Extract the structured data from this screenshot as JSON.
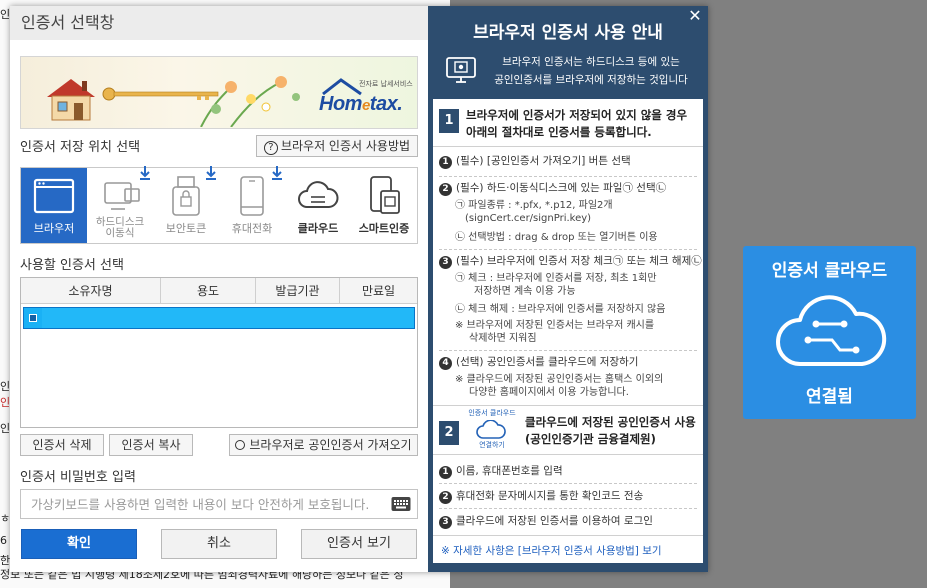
{
  "background": {
    "fragments": [
      "인증",
      "인",
      "인",
      "인",
      "ㅎ",
      "6",
      "한",
      "차",
      "정보 또는 같은 법 시행령 제18조제2호에 따른 범죄경력자료에 해당하는 정보나 같은 정"
    ]
  },
  "dialog": {
    "title": "인증서 선택창",
    "banner": {
      "brand_small": "전자료 납세서비스",
      "brand_home": "Hom",
      "brand_e": "e",
      "brand_tax": "tax."
    },
    "storage_label": "인증서 저장 위치 선택",
    "browser_cert_howto_button": "브라우저 인증서 사용방법",
    "storage_options": [
      {
        "label": "브라우저",
        "icon": "browser-icon"
      },
      {
        "label": "하드디스크\n이동식",
        "icon": "usb-drive-icon"
      },
      {
        "label": "보안토큰",
        "icon": "security-token-icon"
      },
      {
        "label": "휴대전화",
        "icon": "mobile-phone-icon"
      },
      {
        "label": "클라우드",
        "icon": "cloud-icon"
      },
      {
        "label": "스마트인증",
        "icon": "smart-auth-icon"
      }
    ],
    "cert_select_label": "사용할 인증서 선택",
    "table_headers": [
      "소유자명",
      "용도",
      "발급기관",
      "만료일"
    ],
    "delete_cert_button": "인증서 삭제",
    "copy_cert_button": "인증서 복사",
    "import_cert_button": "브라우저로 공인인증서 가져오기",
    "password_label": "인증서 비밀번호 입력",
    "password_placeholder": "가상키보드를 사용하면 입력한 내용이 보다 안전하게 보호됩니다.",
    "confirm_button": "확인",
    "cancel_button": "취소",
    "view_cert_button": "인증서 보기"
  },
  "guide": {
    "title": "브라우저 인증서 사용 안내",
    "subtitle_line1": "브라우저 인증서는 하드디스크 등에 있는",
    "subtitle_line2": "공인인증서를 브라우저에 저장하는 것입니다",
    "step1_num": "1",
    "step1_line1": "브라우저에 인증서가 저장되어 있지 않을 경우",
    "step1_line2": "아래의 절차대로 인증서를 등록합니다.",
    "items": {
      "i1": "(필수) [공인인증서 가져오기] 버튼 선택",
      "i2": "(필수) 하드·이동식디스크에 있는 파일㉠ 선택㉡",
      "i2a": "㉠ 파일종류 : *.pfx, *.p12, 파일2개",
      "i2a2": "(signCert.cer/signPri.key)",
      "i2b": "㉡ 선택방법 : drag & drop 또는 열기버튼 이용",
      "i3": "(필수) 브라우저에 인증서 저장 체크㉠ 또는 체크 해제㉡",
      "i3a": "㉠ 체크 :  브라우저에 인증서를 저장, 최초 1회만",
      "i3a2": "저장하면 계속 이용 가능",
      "i3b": "㉡ 체크 해제 : 브라우저에 인증서를 저장하지 않음",
      "i3c": "※ 브라우저에 저장된 인증서는 브라우저 캐시를",
      "i3c2": "삭제하면 지워짐",
      "i4": "(선택) 공인인증서를 클라우드에 저장하기",
      "i4a": "※ 클라우드에 저장된 공인인증서는 홈택스 이외의",
      "i4a2": "다양한 홈페이지에서 이용 가능합니다."
    },
    "step2_num": "2",
    "step2_icon_top": "인증서 클라우드",
    "step2_icon_bottom": "연결하기",
    "step2_line1": "클라우드에 저장된 공인인증서 사용",
    "step2_line2": "(공인인증기관 금융결제원)",
    "step2_items": [
      "이름, 휴대폰번호를 입력",
      "휴대전화 문자메시지를 통한 확인코드 전송",
      "클라우드에 저장된 인증서를 이용하여 로그인"
    ],
    "more_info": "※ 자세한 사항은 [브라우저 인증서 사용방법] 보기"
  },
  "cloud_badge": {
    "title": "인증서 클라우드",
    "status": "연결됨"
  },
  "colors": {
    "primary": "#1a6ed2",
    "panel": "#2d4d6f",
    "cloud_badge": "#2b8ee3",
    "selected_row": "#1ab1f5"
  }
}
